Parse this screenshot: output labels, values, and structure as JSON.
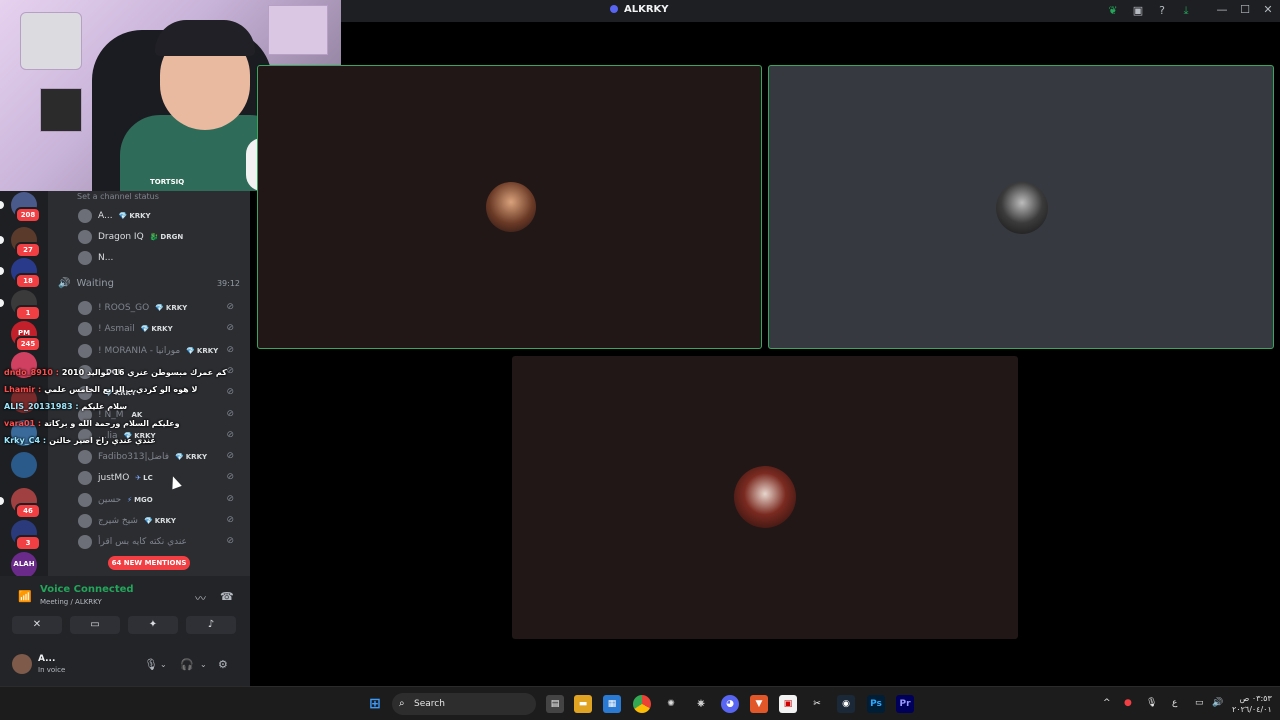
{
  "window": {
    "title": "ALKRKY",
    "minimize": "—",
    "maximize": "☐",
    "close": "✕"
  },
  "servers": [
    {
      "badge": "208"
    },
    {
      "badge": "27"
    },
    {
      "badge": "18"
    },
    {
      "badge": "1"
    },
    {
      "badge": "245",
      "label": "PM"
    },
    {
      "badge": ""
    },
    {
      "badge": ""
    },
    {
      "badge": ""
    },
    {
      "badge": ""
    },
    {
      "badge": "46"
    },
    {
      "badge": "3"
    },
    {
      "badge": "",
      "label": "ALAH"
    },
    {
      "badge": "NEW"
    }
  ],
  "channel": {
    "status_placeholder": "Set a channel status",
    "voice_name": "Waiting",
    "voice_timer": "39:12",
    "new_mentions": "64 NEW MENTIONS"
  },
  "members_top": [
    {
      "name": "A...",
      "tag": "KRKY",
      "gem": "💎"
    },
    {
      "name": "Dragon IQ",
      "tag": "DRGN",
      "gem": "🐉"
    },
    {
      "name": "N...",
      "tag": "",
      "gem": ""
    }
  ],
  "members_waiting": [
    {
      "name": "! ROOS_GO",
      "tag": "KRKY",
      "gem": "💎",
      "dim": true
    },
    {
      "name": "! Asmail",
      "tag": "KRKY",
      "gem": "💎",
      "dim": true
    },
    {
      "name": "! MORANIA - مورانيا",
      "tag": "KRKY",
      "gem": "💎",
      "dim": true
    },
    {
      "name": "",
      "tag": "DGN",
      "gem": "",
      "dim": true
    },
    {
      "name": "",
      "tag": "KRKY",
      "gem": "💎",
      "dim": true
    },
    {
      "name": "! N_M",
      "tag": "AK",
      "gem": "",
      "dim": true
    },
    {
      "name": "…lia",
      "tag": "KRKY",
      "gem": "💎",
      "dim": true
    },
    {
      "name": "Fadibo313|فاضل",
      "tag": "KRKY",
      "gem": "💎",
      "dim": true
    },
    {
      "name": "justMO",
      "tag": "LC",
      "gem": "✈",
      "dim": false
    },
    {
      "name": "حسين",
      "tag": "MGO",
      "gem": "⚡",
      "dim": true
    },
    {
      "name": "شيخ شيرج",
      "tag": "KRKY",
      "gem": "💎",
      "dim": true
    },
    {
      "name": "عندي نكته كايه بس اقرأ",
      "tag": "",
      "gem": "",
      "dim": true
    }
  ],
  "chat_overlay": [
    {
      "user": "dndo_8910 :",
      "text": "كم عمرك مبسوطن عنري 16 مواليد 2010",
      "color": "#ff4d4d"
    },
    {
      "user": "Lhamir :",
      "text": "لا هوه الو كردي بـ الرابع الخامس علمي",
      "color": "#ff4d4d"
    },
    {
      "user": "ALIS_20131983 :",
      "text": "سلام عليكم",
      "color": "#9be8ff"
    },
    {
      "user": "vara01 :",
      "text": "وعليكم السلام ورحمة الله و بركاتة",
      "color": "#ff4d4d"
    },
    {
      "user": "Krky_C4 :",
      "text": "عندي عندي راح اصير خالتن",
      "color": "#9be8ff"
    }
  ],
  "voice_panel": {
    "status": "Voice Connected",
    "location": "Meeting / ALKRKY"
  },
  "user": {
    "name": "A...",
    "status": "In voice"
  },
  "webcam": {
    "brand_text": "TORTSIQ"
  },
  "taskbar": {
    "search_label": "Search",
    "clock_time": "٠٣:٥٣ ص",
    "clock_date": "٢٠٢٦/٠٤/٠١",
    "lang": "ع"
  }
}
